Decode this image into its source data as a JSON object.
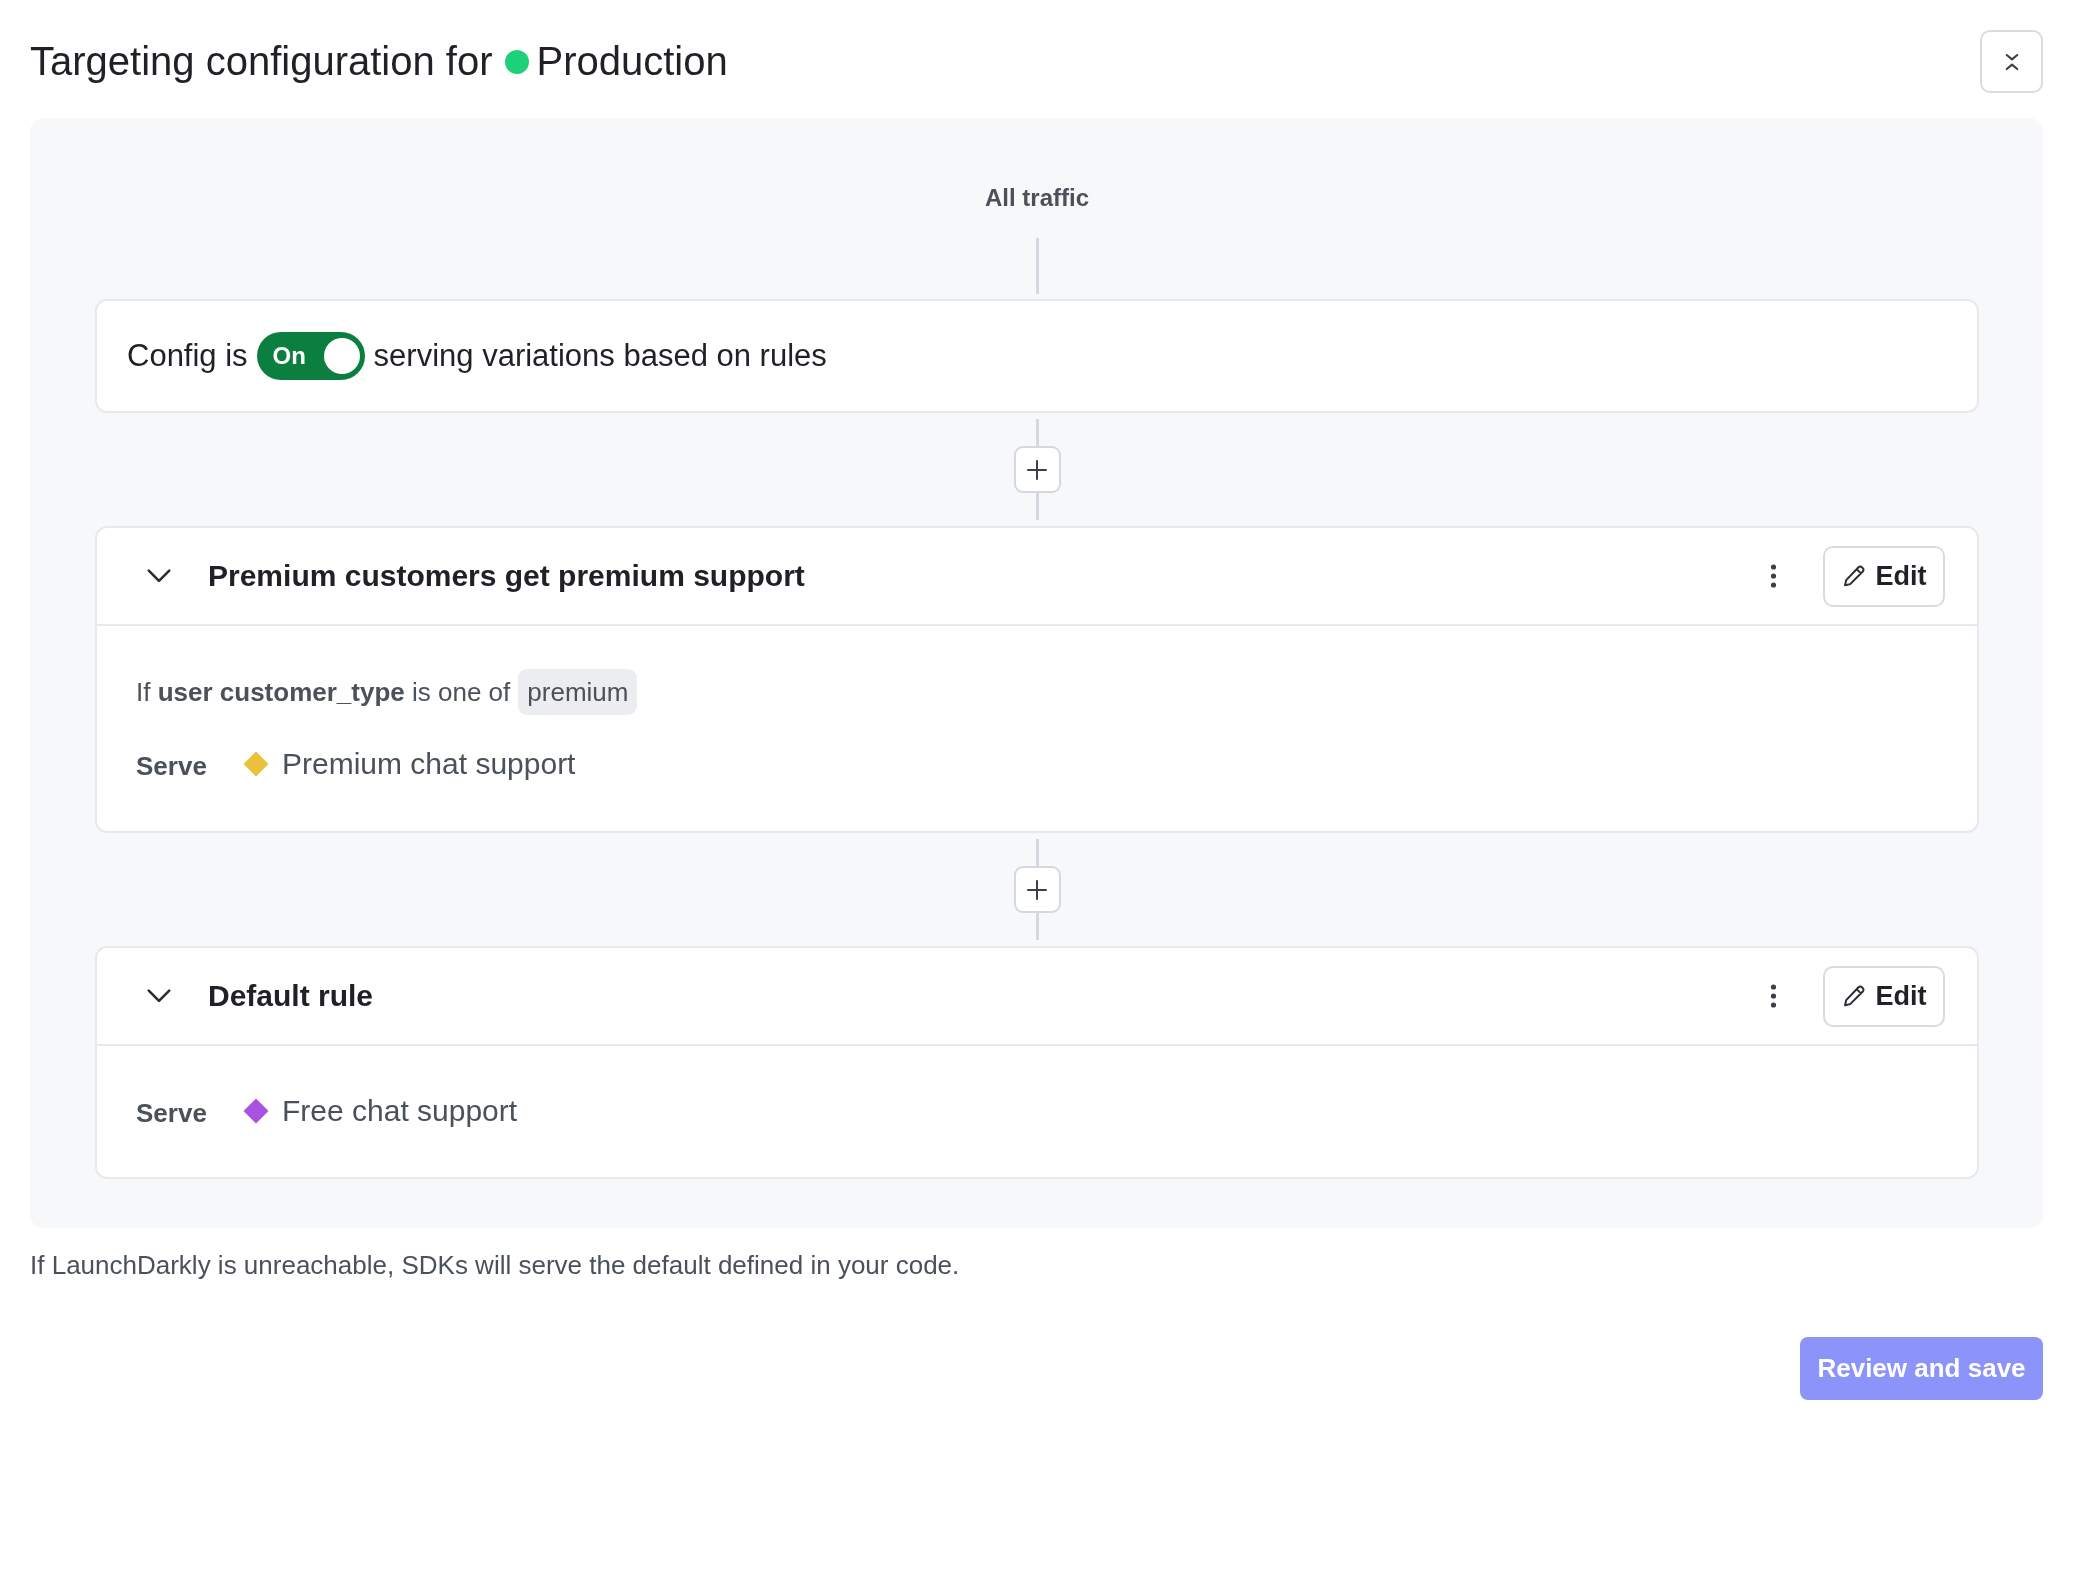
{
  "header": {
    "title": "Targeting configuration for",
    "environment": {
      "name": "Production",
      "color": "#1fd07b"
    }
  },
  "flow": {
    "root_label": "All traffic",
    "status": {
      "prefix": "Config is",
      "toggle": {
        "label": "On",
        "on": true
      },
      "suffix": "serving variations based on rules"
    },
    "rules": [
      {
        "title": "Premium customers get premium support",
        "expanded": true,
        "edit_label": "Edit",
        "condition": {
          "text": "If **user customer_type** is one of",
          "values": [
            "premium"
          ]
        },
        "serve": {
          "label": "Serve",
          "variation": "Premium chat support",
          "color": "#ecc03c"
        }
      },
      {
        "title": "Default rule",
        "expanded": true,
        "edit_label": "Edit",
        "serve": {
          "label": "Serve",
          "variation": "Free chat support",
          "color": "#a653e4"
        }
      }
    ]
  },
  "footnote": "If LaunchDarkly is unreachable, SDKs will serve the default defined in your code.",
  "actions": {
    "review_button": {
      "label": "Review and save",
      "disabled": true
    }
  }
}
